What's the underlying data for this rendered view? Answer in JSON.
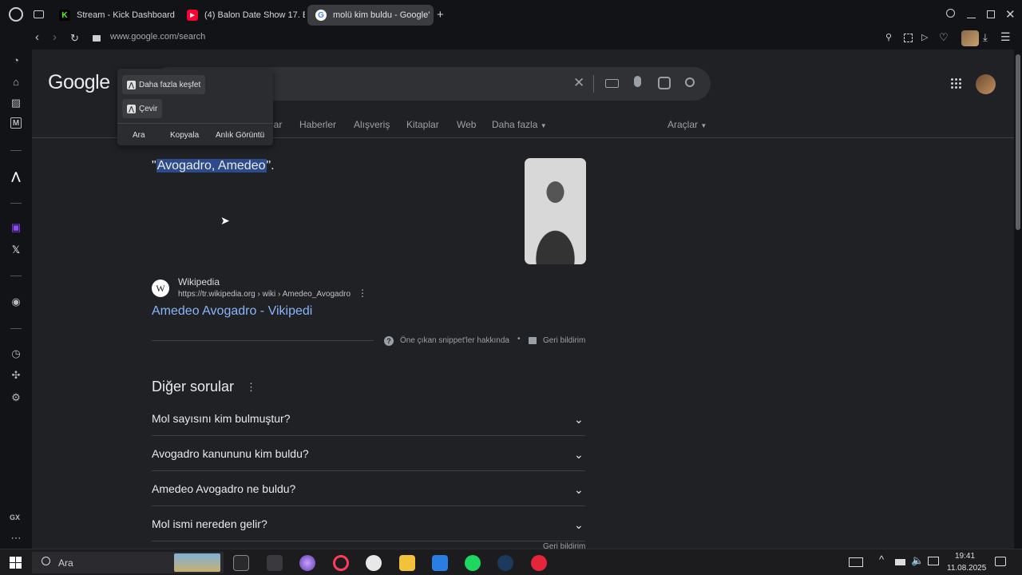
{
  "tabs": [
    {
      "title": "Stream - Kick Dashboard",
      "icon": "kick-icon",
      "color": "#53fc18"
    },
    {
      "title": "(4) Balon Date Show 17. B",
      "icon": "youtube-icon",
      "color": "#ff0033"
    },
    {
      "title": "molü kim buldu - Google'",
      "icon": "google-icon",
      "color": "#ffffff",
      "active": true
    }
  ],
  "address": {
    "url": "www.google.com/search"
  },
  "google": {
    "logo": "Google",
    "nav_tabs": [
      "lar",
      "Haberler",
      "Alışveriş",
      "Kitaplar",
      "Web",
      "Daha fazla"
    ],
    "tools": "Araçlar",
    "snippet_open_quote": "\"",
    "snippet_highlight": "Avogadro, Amedeo",
    "snippet_close_quote": "\".",
    "result": {
      "site_name": "Wikipedia",
      "favicon_letter": "W",
      "url": "https://tr.wikipedia.org › wiki › Amedeo_Avogadro",
      "title": "Amedeo Avogadro - Vikipedi"
    },
    "snippet_about": "Öne çıkan snippet'ler hakkında",
    "feedback": "Geri bildirim",
    "other_questions_title": "Diğer sorular",
    "questions": [
      "Mol sayısını kim bulmuştur?",
      "Avogadro kanununu kim buldu?",
      "Amedeo Avogadro ne buldu?",
      "Mol ismi nereden gelir?"
    ],
    "bottom_feedback": "Geri bildirim"
  },
  "popup": {
    "explore": "Daha fazla keşfet",
    "translate": "Çevir",
    "actions": [
      "Ara",
      "Kopyala",
      "Anlık Görüntü"
    ]
  },
  "sidebar": {
    "gx_label": "GX"
  },
  "taskbar": {
    "search_placeholder": "Ara",
    "time": "19:41",
    "date": "11.08.2025"
  }
}
